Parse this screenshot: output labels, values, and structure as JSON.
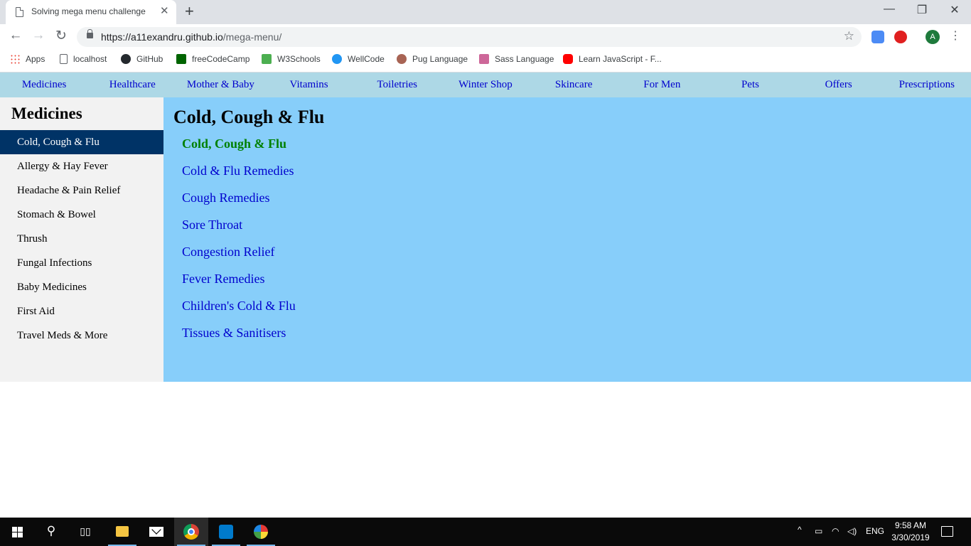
{
  "browser": {
    "tab_title": "Solving mega menu challenge",
    "tab_close": "✕",
    "new_tab": "+",
    "window_controls": {
      "minimize": "—",
      "maximize": "❐",
      "close": "✕"
    },
    "nav": {
      "back": "←",
      "forward": "→",
      "reload": "↻"
    },
    "url_host": "https://a11exandru.github.io",
    "url_path": "/mega-menu/",
    "bookmark_star": "☆",
    "profile_initial": "A",
    "menu": "⋮",
    "bookmarks": [
      {
        "label": "Apps",
        "icon": "apps-icon"
      },
      {
        "label": "localhost",
        "icon": "document-icon"
      },
      {
        "label": "GitHub",
        "icon": "github-icon"
      },
      {
        "label": "freeCodeCamp",
        "icon": "freecodecamp-icon"
      },
      {
        "label": "W3Schools",
        "icon": "w3schools-icon"
      },
      {
        "label": "WellCode",
        "icon": "wellcode-icon"
      },
      {
        "label": "Pug Language",
        "icon": "pug-icon"
      },
      {
        "label": "Sass Language",
        "icon": "sass-icon"
      },
      {
        "label": "Learn JavaScript - F...",
        "icon": "youtube-icon"
      }
    ]
  },
  "page": {
    "top_nav": [
      "Medicines",
      "Healthcare",
      "Mother & Baby",
      "Vitamins",
      "Toiletries",
      "Winter Shop",
      "Skincare",
      "For Men",
      "Pets",
      "Offers",
      "Prescriptions"
    ],
    "sidebar": {
      "title": "Medicines",
      "items": [
        "Cold, Cough & Flu",
        "Allergy & Hay Fever",
        "Headache & Pain Relief",
        "Stomach & Bowel",
        "Thrush",
        "Fungal Infections",
        "Baby Medicines",
        "First Aid",
        "Travel Meds & More"
      ],
      "active_index": 0
    },
    "panel": {
      "title": "Cold, Cough & Flu",
      "links": [
        "Cold, Cough & Flu",
        "Cold & Flu Remedies",
        "Cough Remedies",
        "Sore Throat",
        "Congestion Relief",
        "Fever Remedies",
        "Children's Cold & Flu",
        "Tissues & Sanitisers"
      ],
      "active_index": 0
    },
    "colors": {
      "nav_bg": "#add8e6",
      "link": "#0000cd",
      "sidebar_bg": "#f2f2f2",
      "sidebar_active_bg": "#003366",
      "panel_bg": "#87cefa",
      "panel_active_link": "#008000"
    }
  },
  "taskbar": {
    "search_glyph": "⚲",
    "tray_chevron": "^",
    "language": "ENG",
    "time": "9:58 AM",
    "date": "3/30/2019"
  }
}
